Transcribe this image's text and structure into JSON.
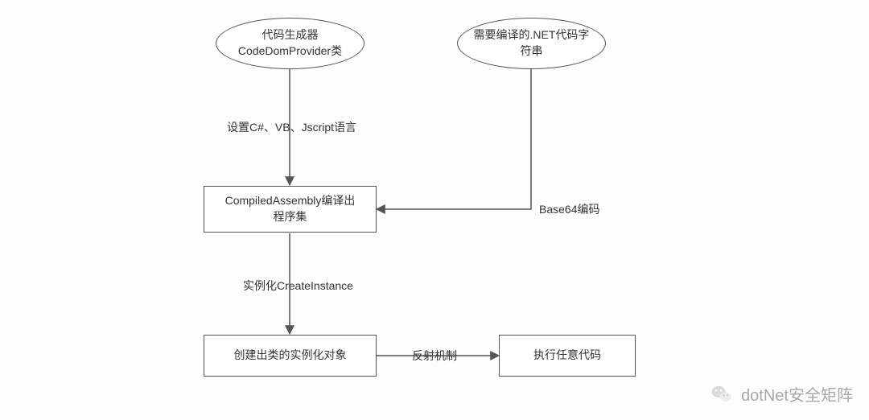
{
  "nodes": {
    "code_generator": {
      "line1": "代码生成器",
      "line2": "CodeDomProvider类"
    },
    "net_source": {
      "line1": "需要编译的.NET代码字",
      "line2": "符串"
    },
    "compiled_asm": {
      "line1": "CompiledAssembly编译出",
      "line2": "程序集"
    },
    "instance_obj": {
      "line1": "创建出类的实例化对象"
    },
    "exec_code": {
      "line1": "执行任意代码"
    }
  },
  "edges": {
    "set_lang": "设置C#、VB、Jscript语言",
    "base64": "Base64编码",
    "create_inst": "实例化CreateInstance",
    "reflection": "反射机制"
  },
  "watermark": {
    "text": "dotNet安全矩阵"
  },
  "chart_data": {
    "type": "flowchart",
    "title": "",
    "nodes": [
      {
        "id": "A",
        "shape": "ellipse",
        "label": "代码生成器 CodeDomProvider类"
      },
      {
        "id": "B",
        "shape": "ellipse",
        "label": "需要编译的.NET代码字符串"
      },
      {
        "id": "C",
        "shape": "rect",
        "label": "CompiledAssembly编译出程序集"
      },
      {
        "id": "D",
        "shape": "rect",
        "label": "创建出类的实例化对象"
      },
      {
        "id": "E",
        "shape": "rect",
        "label": "执行任意代码"
      }
    ],
    "edges": [
      {
        "from": "A",
        "to": "C",
        "label": "设置C#、VB、Jscript语言"
      },
      {
        "from": "B",
        "to": "C",
        "label": "Base64编码"
      },
      {
        "from": "C",
        "to": "D",
        "label": "实例化CreateInstance"
      },
      {
        "from": "D",
        "to": "E",
        "label": "反射机制"
      }
    ]
  }
}
